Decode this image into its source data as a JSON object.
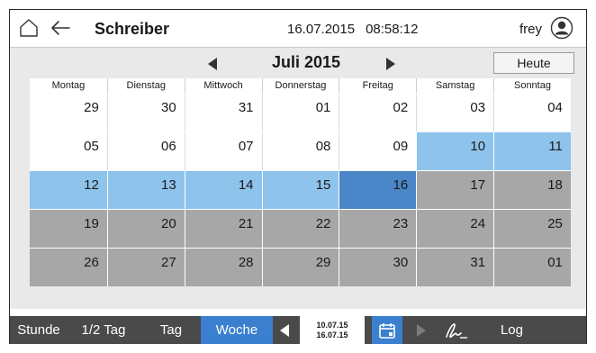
{
  "header": {
    "title": "Schreiber",
    "date": "16.07.2015",
    "time": "08:58:12",
    "user": "frey",
    "icons": [
      "home-icon",
      "back-arrow-icon",
      "user-icon"
    ]
  },
  "calendar": {
    "month_label": "Juli 2015",
    "today_button": "Heute",
    "weekdays": [
      "Montag",
      "Dienstag",
      "Mittwoch",
      "Donnerstag",
      "Freitag",
      "Samstag",
      "Sonntag"
    ],
    "weeks": [
      [
        "29",
        "30",
        "31",
        "01",
        "02",
        "03",
        "04"
      ],
      [
        "05",
        "06",
        "07",
        "08",
        "09",
        "10",
        "11"
      ],
      [
        "12",
        "13",
        "14",
        "15",
        "16",
        "17",
        "18"
      ],
      [
        "19",
        "20",
        "21",
        "22",
        "23",
        "24",
        "25"
      ],
      [
        "26",
        "27",
        "28",
        "29",
        "30",
        "31",
        "01"
      ]
    ],
    "selected_day": "16",
    "colors": {
      "range_highlight": "#8ec3ec",
      "selected": "#4a86c8",
      "future": "#a7a7a7"
    }
  },
  "toolbar": {
    "stunde": "Stunde",
    "halbtag": "1/2 Tag",
    "tag": "Tag",
    "woche": "Woche",
    "range_start": "10.07.15",
    "range_end": "16.07.15",
    "log": "Log",
    "active_color": "#3b7fcf"
  }
}
